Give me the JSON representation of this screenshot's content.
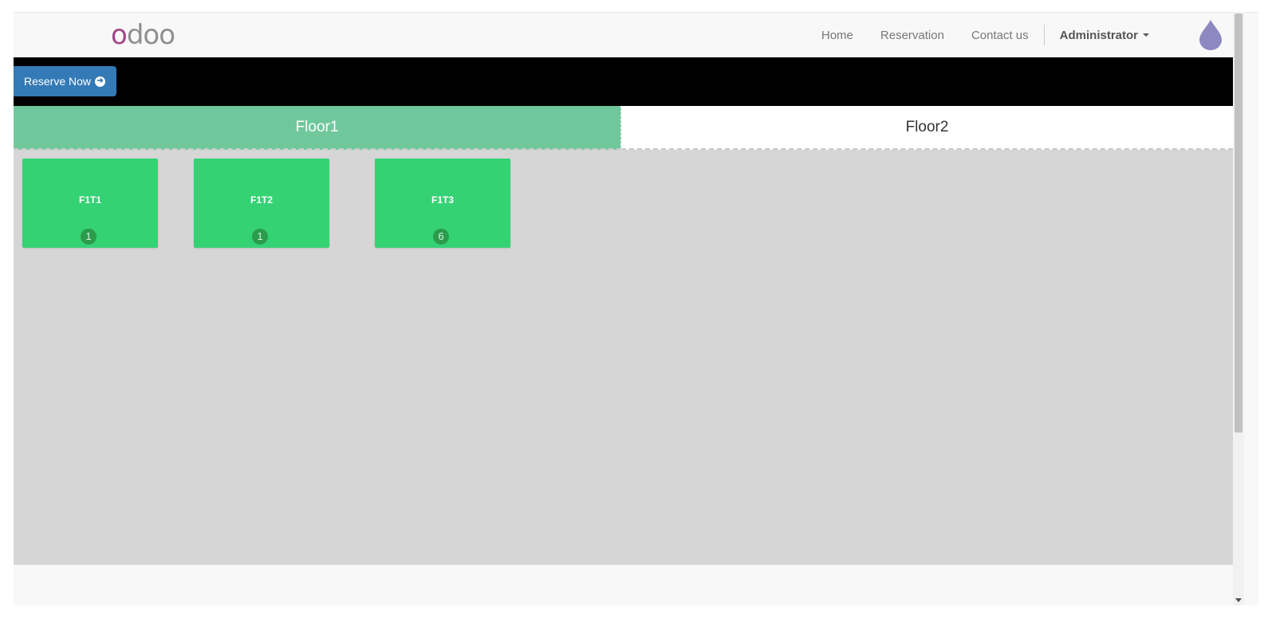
{
  "navbar": {
    "logo_first": "o",
    "logo_rest": "doo",
    "links": [
      "Home",
      "Reservation",
      "Contact us"
    ],
    "user": "Administrator"
  },
  "action": {
    "reserve_label": "Reserve Now"
  },
  "floors": [
    {
      "label": "Floor1",
      "active": true
    },
    {
      "label": "Floor2",
      "active": false
    }
  ],
  "tables": [
    {
      "name": "F1T1",
      "seats": "1"
    },
    {
      "name": "F1T2",
      "seats": "1"
    },
    {
      "name": "F1T3",
      "seats": "6"
    }
  ],
  "colors": {
    "logo_o": "#a24689",
    "reserve_button": "#337ab7",
    "active_tab": "#70c79b",
    "table_card": "#35d274",
    "floor_background": "#d6d6d6"
  },
  "icons": [
    "arrow-circle-right-icon",
    "caret-down-icon",
    "theme-drop-icon"
  ]
}
